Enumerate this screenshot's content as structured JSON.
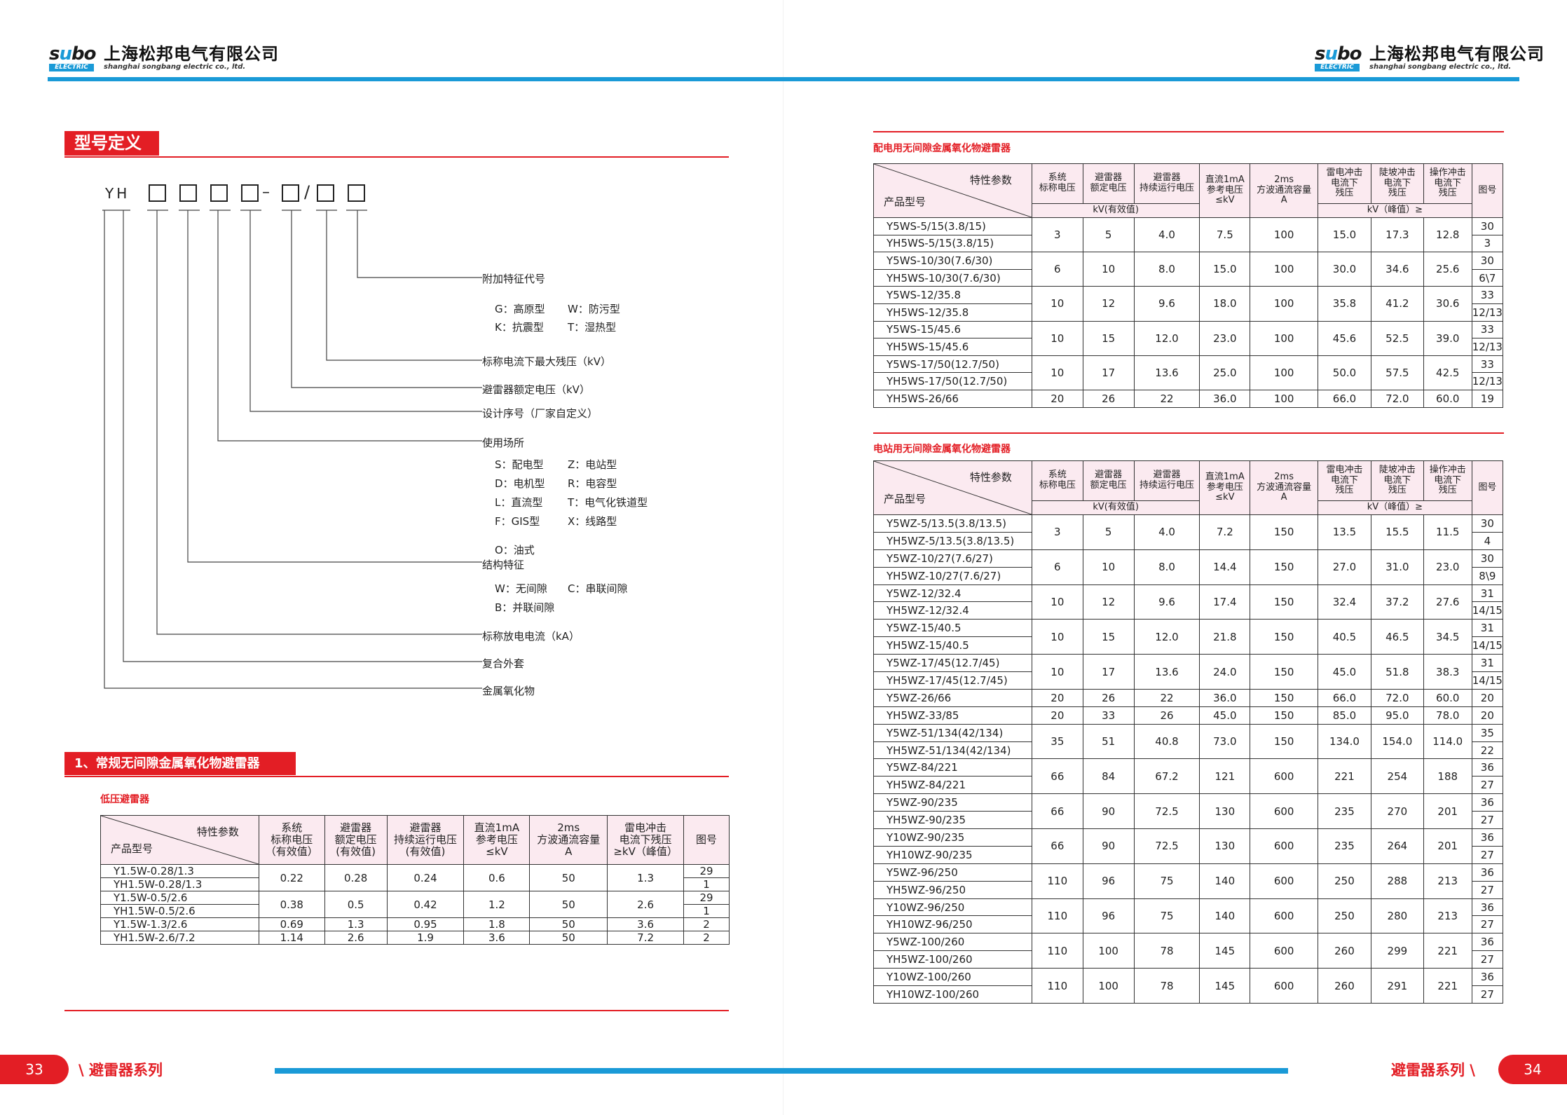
{
  "brand": {
    "logo_wordmark": "subo",
    "logo_tag": "ELECTRIC",
    "company_cn": "上海松邦电气有限公司",
    "company_en": "shanghai songbang electric co., ltd."
  },
  "model_definition": {
    "title": "型号定义",
    "prefix": "YH",
    "labels": [
      "附加特征代号",
      "G：高原型",
      "W：防污型",
      "K：抗震型",
      "T：湿热型",
      "标称电流下最大残压（kV）",
      "避雷器额定电压（kV）",
      "设计序号（厂家自定义）",
      "使用场所",
      "S：配电型",
      "Z：电站型",
      "D：电机型",
      "R：电容型",
      "L：直流型",
      "T：电气化铁道型",
      "F：GIS型",
      "X：线路型",
      "O：油式",
      "结构特征",
      "W：无间隙",
      "C：串联间隙",
      "B：并联间隙",
      "标称放电电流（kA）",
      "复合外套",
      "金属氧化物"
    ]
  },
  "section1": {
    "title": "1、常规无间隙金属氧化物避雷器",
    "subtitle": "低压避雷器",
    "headers": {
      "diag_top": "特性参数",
      "diag_bottom": "产品型号",
      "cols": [
        "系统\n标称电压\n（有效值）",
        "避雷器\n额定电压\n(有效值)",
        "避雷器\n持续运行电压\n(有效值)",
        "直流1mA\n参考电压\n≤kV",
        "2ms\n方波通流容量\nA",
        "雷电冲击\n电流下残压\n≥kV（峰值）",
        "图号"
      ]
    },
    "rows": [
      {
        "models": [
          "Y1.5W-0.28/1.3",
          "YH1.5W-0.28/1.3"
        ],
        "vals": [
          "0.22",
          "0.28",
          "0.24",
          "0.6",
          "50",
          "1.3"
        ],
        "figs": [
          "29",
          "1"
        ]
      },
      {
        "models": [
          "Y1.5W-0.5/2.6",
          "YH1.5W-0.5/2.6"
        ],
        "vals": [
          "0.38",
          "0.5",
          "0.42",
          "1.2",
          "50",
          "2.6"
        ],
        "figs": [
          "29",
          "1"
        ]
      },
      {
        "models": [
          "Y1.5W-1.3/2.6"
        ],
        "vals": [
          "0.69",
          "1.3",
          "0.95",
          "1.8",
          "50",
          "3.6"
        ],
        "figs": [
          "2"
        ]
      },
      {
        "models": [
          "YH1.5W-2.6/7.2"
        ],
        "vals": [
          "1.14",
          "2.6",
          "1.9",
          "3.6",
          "50",
          "7.2"
        ],
        "figs": [
          "2"
        ]
      }
    ]
  },
  "distribution": {
    "subtitle": "配电用无间隙金属氧化物避雷器",
    "headers": {
      "diag_top": "特性参数",
      "diag_bottom": "产品型号",
      "cols": [
        "系统\n标称电压",
        "避雷器\n额定电压",
        "避雷器\n持续运行电压",
        "直流1mA\n参考电压\n≤kV",
        "2ms\n方波通流容量\nA",
        "雷电冲击\n电流下\n残压",
        "陡坡冲击\n电流下\n残压",
        "操作冲击\n电流下\n残压",
        "图号"
      ],
      "unit_left": "kV(有效值)",
      "unit_right": "kV（峰值）≥"
    },
    "rows": [
      {
        "models": [
          "Y5WS-5/15(3.8/15)",
          "YH5WS-5/15(3.8/15)"
        ],
        "vals": [
          "3",
          "5",
          "4.0",
          "7.5",
          "100",
          "15.0",
          "17.3",
          "12.8"
        ],
        "figs": [
          "30",
          "3"
        ]
      },
      {
        "models": [
          "Y5WS-10/30(7.6/30)",
          "YH5WS-10/30(7.6/30)"
        ],
        "vals": [
          "6",
          "10",
          "8.0",
          "15.0",
          "100",
          "30.0",
          "34.6",
          "25.6"
        ],
        "figs": [
          "30",
          "6\\7"
        ]
      },
      {
        "models": [
          "Y5WS-12/35.8",
          "YH5WS-12/35.8"
        ],
        "vals": [
          "10",
          "12",
          "9.6",
          "18.0",
          "100",
          "35.8",
          "41.2",
          "30.6"
        ],
        "figs": [
          "33",
          "12/13"
        ]
      },
      {
        "models": [
          "Y5WS-15/45.6",
          "YH5WS-15/45.6"
        ],
        "vals": [
          "10",
          "15",
          "12.0",
          "23.0",
          "100",
          "45.6",
          "52.5",
          "39.0"
        ],
        "figs": [
          "33",
          "12/13"
        ]
      },
      {
        "models": [
          "Y5WS-17/50(12.7/50)",
          "YH5WS-17/50(12.7/50)"
        ],
        "vals": [
          "10",
          "17",
          "13.6",
          "25.0",
          "100",
          "50.0",
          "57.5",
          "42.5"
        ],
        "figs": [
          "33",
          "12/13"
        ]
      },
      {
        "models": [
          "YH5WS-26/66"
        ],
        "vals": [
          "20",
          "26",
          "22",
          "36.0",
          "100",
          "66.0",
          "72.0",
          "60.0"
        ],
        "figs": [
          "19"
        ]
      }
    ]
  },
  "station": {
    "subtitle": "电站用无间隙金属氧化物避雷器",
    "headers": {
      "diag_top": "特性参数",
      "diag_bottom": "产品型号",
      "cols": [
        "系统\n标称电压",
        "避雷器\n额定电压",
        "避雷器\n持续运行电压",
        "直流1mA\n参考电压\n≤kV",
        "2ms\n方波通流容量\nA",
        "雷电冲击\n电流下\n残压",
        "陡坡冲击\n电流下\n残压",
        "操作冲击\n电流下\n残压",
        "图号"
      ],
      "unit_left": "kV(有效值)",
      "unit_right": "kV（峰值）≥"
    },
    "rows": [
      {
        "models": [
          "Y5WZ-5/13.5(3.8/13.5)",
          "YH5WZ-5/13.5(3.8/13.5)"
        ],
        "vals": [
          "3",
          "5",
          "4.0",
          "7.2",
          "150",
          "13.5",
          "15.5",
          "11.5"
        ],
        "figs": [
          "30",
          "4"
        ]
      },
      {
        "models": [
          "Y5WZ-10/27(7.6/27)",
          "YH5WZ-10/27(7.6/27)"
        ],
        "vals": [
          "6",
          "10",
          "8.0",
          "14.4",
          "150",
          "27.0",
          "31.0",
          "23.0"
        ],
        "figs": [
          "30",
          "8\\9"
        ]
      },
      {
        "models": [
          "Y5WZ-12/32.4",
          "YH5WZ-12/32.4"
        ],
        "vals": [
          "10",
          "12",
          "9.6",
          "17.4",
          "150",
          "32.4",
          "37.2",
          "27.6"
        ],
        "figs": [
          "31",
          "14/15"
        ]
      },
      {
        "models": [
          "Y5WZ-15/40.5",
          "YH5WZ-15/40.5"
        ],
        "vals": [
          "10",
          "15",
          "12.0",
          "21.8",
          "150",
          "40.5",
          "46.5",
          "34.5"
        ],
        "figs": [
          "31",
          "14/15"
        ]
      },
      {
        "models": [
          "Y5WZ-17/45(12.7/45)",
          "YH5WZ-17/45(12.7/45)"
        ],
        "vals": [
          "10",
          "17",
          "13.6",
          "24.0",
          "150",
          "45.0",
          "51.8",
          "38.3"
        ],
        "figs": [
          "31",
          "14/15"
        ]
      },
      {
        "models": [
          "Y5WZ-26/66"
        ],
        "vals": [
          "20",
          "26",
          "22",
          "36.0",
          "150",
          "66.0",
          "72.0",
          "60.0"
        ],
        "figs": [
          "20"
        ]
      },
      {
        "models": [
          "YH5WZ-33/85"
        ],
        "vals": [
          "20",
          "33",
          "26",
          "45.0",
          "150",
          "85.0",
          "95.0",
          "78.0"
        ],
        "figs": [
          "20"
        ]
      },
      {
        "models": [
          "Y5WZ-51/134(42/134)",
          "YH5WZ-51/134(42/134)"
        ],
        "vals": [
          "35",
          "51",
          "40.8",
          "73.0",
          "150",
          "134.0",
          "154.0",
          "114.0"
        ],
        "figs": [
          "35",
          "22"
        ]
      },
      {
        "models": [
          "Y5WZ-84/221",
          "YH5WZ-84/221"
        ],
        "vals": [
          "66",
          "84",
          "67.2",
          "121",
          "600",
          "221",
          "254",
          "188"
        ],
        "figs": [
          "36",
          "27"
        ]
      },
      {
        "models": [
          "Y5WZ-90/235",
          "YH5WZ-90/235"
        ],
        "vals": [
          "66",
          "90",
          "72.5",
          "130",
          "600",
          "235",
          "270",
          "201"
        ],
        "figs": [
          "36",
          "27"
        ]
      },
      {
        "models": [
          "Y10WZ-90/235",
          "YH10WZ-90/235"
        ],
        "vals": [
          "66",
          "90",
          "72.5",
          "130",
          "600",
          "235",
          "264",
          "201"
        ],
        "figs": [
          "36",
          "27"
        ]
      },
      {
        "models": [
          "Y5WZ-96/250",
          "YH5WZ-96/250"
        ],
        "vals": [
          "110",
          "96",
          "75",
          "140",
          "600",
          "250",
          "288",
          "213"
        ],
        "figs": [
          "36",
          "27"
        ]
      },
      {
        "models": [
          "Y10WZ-96/250",
          "YH10WZ-96/250"
        ],
        "vals": [
          "110",
          "96",
          "75",
          "140",
          "600",
          "250",
          "280",
          "213"
        ],
        "figs": [
          "36",
          "27"
        ]
      },
      {
        "models": [
          "Y5WZ-100/260",
          "YH5WZ-100/260"
        ],
        "vals": [
          "110",
          "100",
          "78",
          "145",
          "600",
          "260",
          "299",
          "221"
        ],
        "figs": [
          "36",
          "27"
        ]
      },
      {
        "models": [
          "Y10WZ-100/260",
          "YH10WZ-100/260"
        ],
        "vals": [
          "110",
          "100",
          "78",
          "145",
          "600",
          "260",
          "291",
          "221"
        ],
        "figs": [
          "36",
          "27"
        ]
      }
    ]
  },
  "footer": {
    "page_left": "33",
    "page_right": "34",
    "series_left": "\\ 避雷器系列",
    "series_right": "避雷器系列 \\"
  },
  "colors": {
    "accent_red": "#e31e25",
    "accent_blue": "#1a9ad7",
    "header_pink": "#fbeaf0"
  }
}
